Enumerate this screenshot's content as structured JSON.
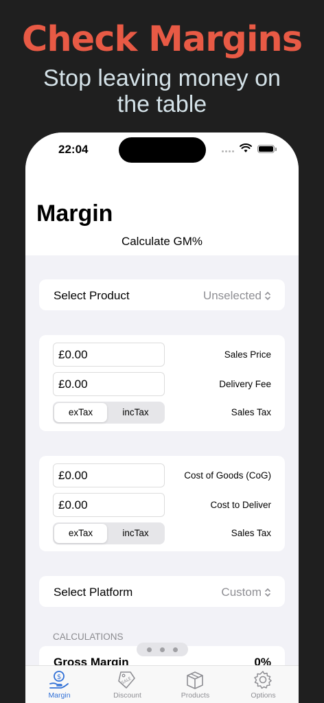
{
  "promo": {
    "title": "Check Margins",
    "subtitle_line1": "Stop leaving money on",
    "subtitle_line2": "the table"
  },
  "status_bar": {
    "time": "22:04",
    "icons": [
      "signal-icon",
      "wifi-icon",
      "battery-icon"
    ]
  },
  "header": {
    "title": "Margin",
    "subtitle": "Calculate GM%"
  },
  "product_picker": {
    "label": "Select Product",
    "value": "Unselected",
    "icon": "chevron-updown-icon"
  },
  "sales_card": {
    "sales_price": {
      "value": "£0.00",
      "label": "Sales Price"
    },
    "delivery_fee": {
      "value": "£0.00",
      "label": "Delivery Fee"
    },
    "tax": {
      "options": [
        "exTax",
        "incTax"
      ],
      "selected": "exTax",
      "label": "Sales Tax"
    }
  },
  "cost_card": {
    "cost_of_goods": {
      "value": "£0.00",
      "label": "Cost of Goods (CoG)"
    },
    "cost_to_deliver": {
      "value": "£0.00",
      "label": "Cost to Deliver"
    },
    "tax": {
      "options": [
        "exTax",
        "incTax"
      ],
      "selected": "exTax",
      "label": "Sales Tax"
    }
  },
  "platform_picker": {
    "label": "Select Platform",
    "value": "Custom",
    "icon": "chevron-updown-icon"
  },
  "calculations": {
    "header": "CALCULATIONS",
    "gross_margin": {
      "label": "Gross Margin",
      "value": "0%"
    }
  },
  "tab_bar": {
    "tabs": [
      {
        "label": "Margin",
        "icon": "money-hand-icon",
        "active": true
      },
      {
        "label": "Discount",
        "icon": "sale-tag-icon",
        "active": false
      },
      {
        "label": "Products",
        "icon": "box-icon",
        "active": false
      },
      {
        "label": "Options",
        "icon": "gear-icon",
        "active": false
      }
    ]
  },
  "colors": {
    "promo_title": "#e85a45",
    "promo_subtitle": "#d4e2e8",
    "accent": "#2f6fd6",
    "background": "#1f1f1f"
  }
}
